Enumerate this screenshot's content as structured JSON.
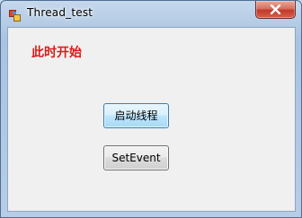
{
  "window": {
    "title": "Thread_test",
    "icon": "app-icon",
    "close_icon": "close-icon"
  },
  "main": {
    "status_text": "此时开始",
    "status_color": "#dd1a1a",
    "start_thread_button": "启动线程",
    "set_event_button": "SetEvent"
  }
}
